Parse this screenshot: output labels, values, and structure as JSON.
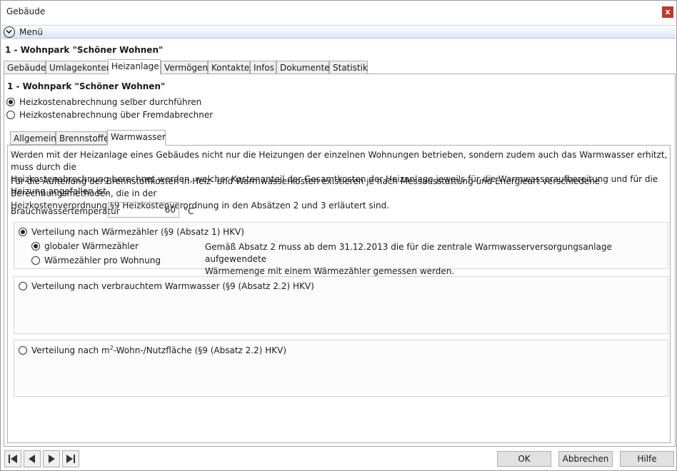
{
  "window": {
    "title": "Gebäude",
    "close": "x"
  },
  "menu": {
    "label": "Menü"
  },
  "header": {
    "title": "1 - Wohnpark \"Schöner Wohnen\""
  },
  "main_tabs": [
    "Gebäude",
    "Umlagekonten",
    "Heizanlage",
    "Vermögen",
    "Kontakte",
    "Infos",
    "Dokumente",
    "Statistik"
  ],
  "active_main_tab": "Heizanlage",
  "panel": {
    "subheader": "1 - Wohnpark \"Schöner Wohnen\"",
    "billing_options": [
      {
        "label": "Heizkostenabrechnung selber durchführen",
        "selected": true
      },
      {
        "label": "Heizkostenabrechnung über Fremdabrechner",
        "selected": false
      }
    ],
    "sub_tabs": [
      "Allgemein",
      "Brennstoffe",
      "Warmwasser"
    ],
    "active_sub_tab": "Warmwasser"
  },
  "warmwasser": {
    "para1_line1": "Werden mit der Heizanlage eines Gebäudes nicht nur die Heizungen der einzelnen Wohnungen betrieben, sondern zudem auch das Warmwasser erhitzt, muss durch die",
    "para1_line2": "Heizkostenabrechnung berechnet werden, welcher Kostenanteil der Gesamtkosten der Heizanlage jeweils für die Warmwasseraufbereitung und für die Heizung angefallen ist.",
    "para2_line1": "Für die Aufteilung der Brennstoffkosten in Heiz- und Warmwasserkosten existieren je nach Messausstattung und Energieart verschiedene Berechnungsmethoden, die in der",
    "para2_line2": "Heizkostenverordnung §9 Heizkostenverordnung in den Absätzen 2 und 3 erläutert sind.",
    "temp_label": "Brauchwassertemperatur",
    "temp_value": "60",
    "temp_unit": "°C",
    "group1": {
      "label": "Verteilung nach Wärmezähler (§9 (Absatz 1) HKV)",
      "selected": true,
      "options": [
        {
          "label": "globaler Wärmezähler",
          "selected": true
        },
        {
          "label": "Wärmezähler pro Wohnung",
          "selected": false
        }
      ],
      "note_line1": "Gemäß Absatz 2 muss ab dem 31.12.2013 die für die zentrale Warmwasserversorgungsanlage aufgewendete",
      "note_line2": "Wärmemenge mit einem Wärmezähler gemessen werden."
    },
    "group2": {
      "label": "Verteilung nach verbrauchtem Warmwasser (§9 (Absatz 2.2) HKV)",
      "selected": false
    },
    "group3": {
      "label_pre": "Verteilung nach m",
      "label_sup": "2",
      "label_post": "-Wohn-/Nutzfläche (§9 (Absatz 2.2) HKV)",
      "selected": false
    }
  },
  "footer": {
    "nav": [
      "first-icon",
      "previous-icon",
      "next-icon",
      "last-icon"
    ],
    "ok": "OK",
    "cancel": "Abbrechen",
    "help": "Hilfe"
  }
}
